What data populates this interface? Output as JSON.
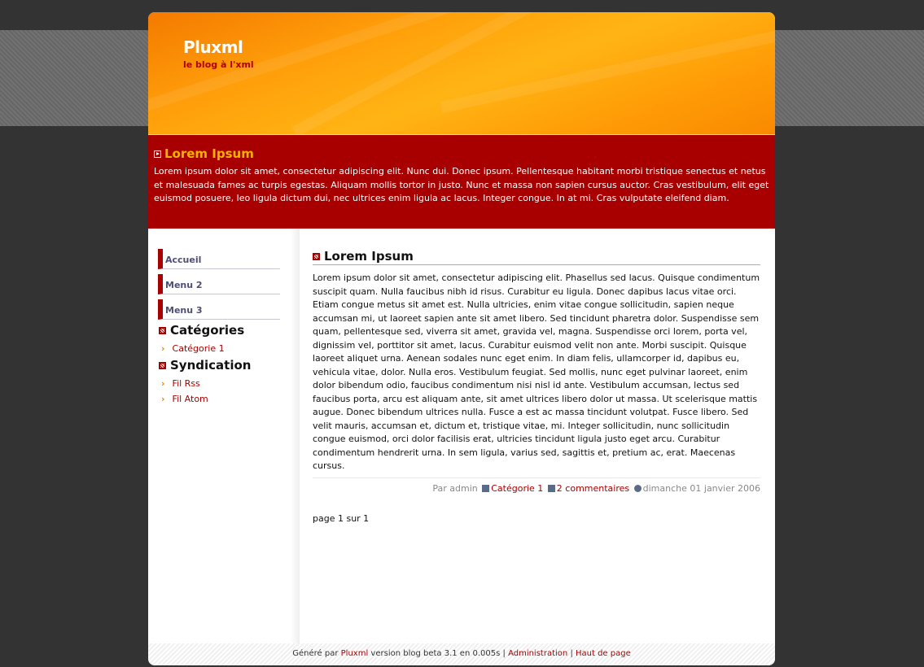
{
  "header": {
    "title": "Pluxml",
    "tagline": "le blog à l'xml"
  },
  "featured": {
    "title": "Lorem Ipsum",
    "text": "Lorem ipsum dolor sit amet, consectetur adipiscing elit. Nunc dui. Donec ipsum. Pellentesque habitant morbi tristique senectus et netus et malesuada fames ac turpis egestas. Aliquam mollis tortor in justo. Nunc et massa non sapien cursus auctor. Cras vestibulum, elit eget euismod posuere, leo ligula dictum dui, nec ultrices enim ligula ac lacus. Integer congue. In at mi. Cras vulputate eleifend diam."
  },
  "sidebar": {
    "menu": [
      "Accueil",
      "Menu 2",
      "Menu 3"
    ],
    "categories_heading": "Catégories",
    "categories": [
      "Catégorie 1"
    ],
    "syndication_heading": "Syndication",
    "syndication": [
      "Fil Rss",
      "Fil Atom"
    ]
  },
  "post": {
    "title": "Lorem Ipsum",
    "body": "Lorem ipsum dolor sit amet, consectetur adipiscing elit. Phasellus sed lacus. Quisque condimentum suscipit quam. Nulla faucibus nibh id risus. Curabitur eu ligula. Donec dapibus lacus vitae orci. Etiam congue metus sit amet est. Nulla ultricies, enim vitae congue sollicitudin, sapien neque accumsan mi, ut laoreet sapien ante sit amet libero. Sed tincidunt pharetra dolor. Suspendisse sem quam, pellentesque sed, viverra sit amet, gravida vel, magna. Suspendisse orci lorem, porta vel, dignissim vel, porttitor sit amet, lacus. Curabitur euismod velit non ante. Morbi suscipit. Quisque laoreet aliquet urna. Aenean sodales nunc eget enim. In diam felis, ullamcorper id, dapibus eu, vehicula vitae, dolor. Nulla eros. Vestibulum feugiat. Sed mollis, nunc eget pulvinar laoreet, enim dolor bibendum odio, faucibus condimentum nisi nisl id ante. Vestibulum accumsan, lectus sed faucibus porta, arcu est aliquam ante, sit amet ultrices libero dolor ut massa. Ut scelerisque mattis augue. Donec bibendum ultrices nulla. Fusce a est ac massa tincidunt volutpat. Fusce libero. Sed velit mauris, accumsan et, dictum et, tristique vitae, mi. Integer sollicitudin, nunc sollicitudin congue euismod, orci dolor facilisis erat, ultricies tincidunt ligula justo eget arcu. Curabitur condimentum hendrerit urna. In sem ligula, varius sed, sagittis et, pretium ac, erat. Maecenas cursus.",
    "meta": {
      "author": "Par admin",
      "category": "Catégorie 1",
      "comments": "2 commentaires",
      "date": "dimanche 01 janvier 2006"
    },
    "pagination": "page 1 sur 1"
  },
  "footer": {
    "prefix": "Généré par",
    "pluxml_link": "Pluxml",
    "version": "version blog beta 3.1 en 0.005s |",
    "admin_link": "Administration",
    "separator": "|",
    "top_link": "Haut de page"
  },
  "colors": {
    "accent_red": "#a80000",
    "header_orange": "#ff9f0a",
    "featured_title": "#ffb100",
    "background": "#333333"
  }
}
